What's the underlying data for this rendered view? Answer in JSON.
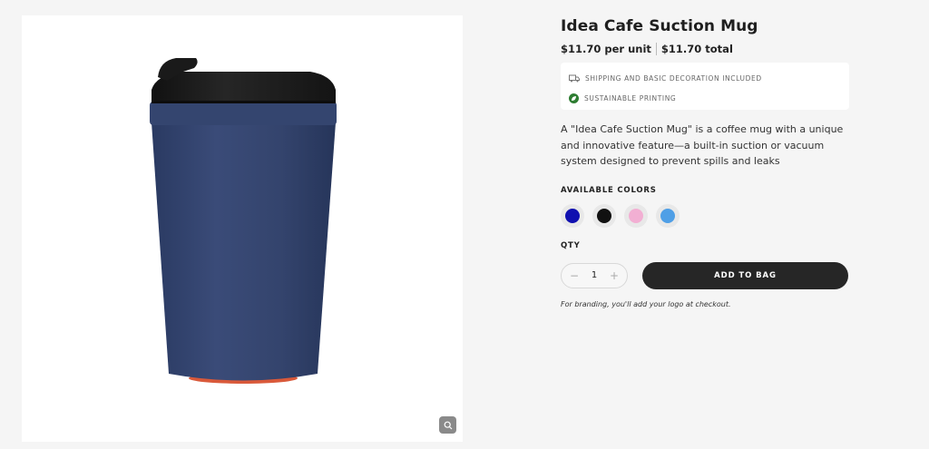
{
  "product": {
    "title": "Idea Cafe Suction Mug",
    "price_unit": "$11.70 per unit",
    "price_total": "$11.70 total",
    "features": [
      {
        "icon": "truck-icon",
        "text": "SHIPPING AND BASIC DECORATION INCLUDED"
      },
      {
        "icon": "leaf-icon",
        "text": "SUSTAINABLE PRINTING"
      }
    ],
    "description": "A \"Idea Cafe Suction Mug\" is a coffee mug with a unique and innovative feature—a built-in suction or vacuum system designed to prevent spills and leaks",
    "image": {
      "icon": "mug-image",
      "colors": {
        "body": "#34446d",
        "lid": "#1c1c1c",
        "base": "#d9593a"
      }
    }
  },
  "colors": {
    "label": "AVAILABLE COLORS",
    "options": [
      {
        "name": "blue",
        "hex": "#1010b0"
      },
      {
        "name": "black",
        "hex": "#111111"
      },
      {
        "name": "pink",
        "hex": "#f2afd3"
      },
      {
        "name": "light-blue",
        "hex": "#4f9fe6"
      }
    ]
  },
  "qty": {
    "label": "QTY",
    "value": "1",
    "minus": "−",
    "plus": "+"
  },
  "actions": {
    "add_to_bag": "ADD TO BAG"
  },
  "note": "For branding, you'll add your logo at checkout."
}
